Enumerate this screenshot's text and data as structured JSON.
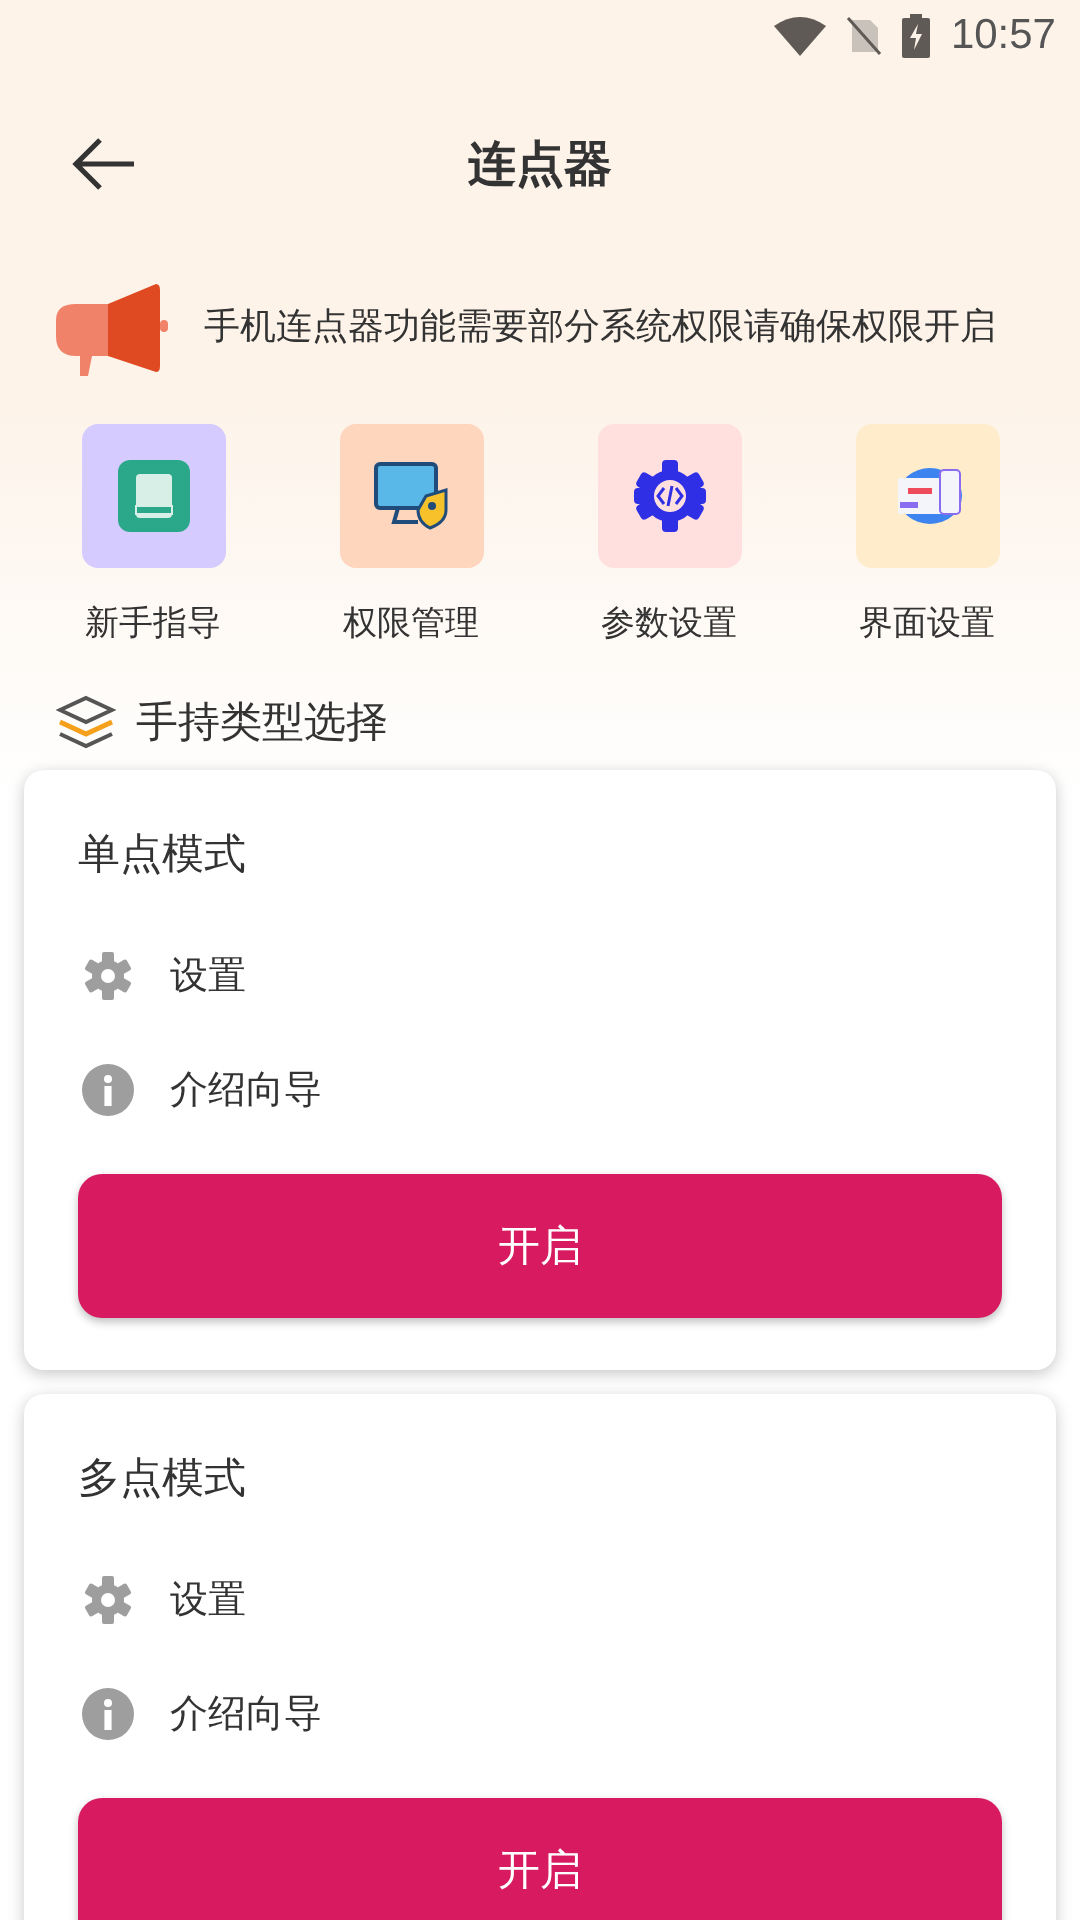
{
  "status_bar": {
    "time": "10:57"
  },
  "header": {
    "title": "连点器"
  },
  "notice": {
    "text": "手机连点器功能需要部分系统权限请确保权限开启"
  },
  "shortcuts": [
    {
      "label": "新手指导",
      "kind": "book",
      "color": "#d6cbff"
    },
    {
      "label": "权限管理",
      "kind": "monitor",
      "color": "#fed5bd"
    },
    {
      "label": "参数设置",
      "kind": "gear",
      "color": "#ffe0df"
    },
    {
      "label": "界面设置",
      "kind": "screens",
      "color": "#ffeccb"
    }
  ],
  "section": {
    "title": "手持类型选择"
  },
  "modes": [
    {
      "title": "单点模式",
      "items": [
        {
          "kind": "settings",
          "label": "设置"
        },
        {
          "kind": "info",
          "label": "介绍向导"
        }
      ],
      "button": "开启"
    },
    {
      "title": "多点模式",
      "items": [
        {
          "kind": "settings",
          "label": "设置"
        },
        {
          "kind": "info",
          "label": "介绍向导"
        }
      ],
      "button": "开启"
    }
  ]
}
